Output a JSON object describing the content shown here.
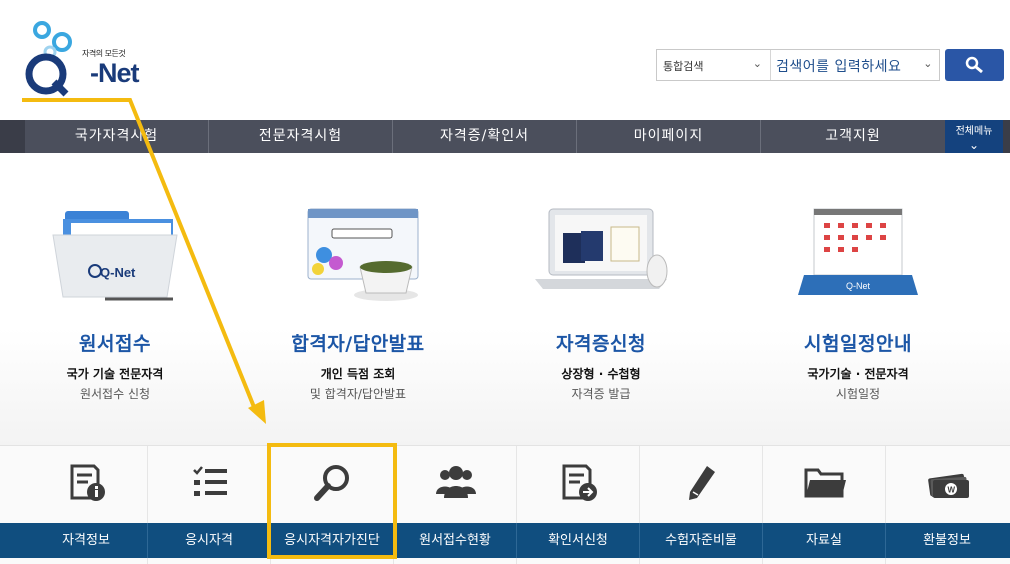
{
  "header": {
    "logo_slogan": "자격의 모든것",
    "logo_brand": "-Net",
    "search": {
      "category": "통합검색",
      "placeholder": "검색어를 입력하세요"
    }
  },
  "gnb": {
    "items": [
      "국가자격시험",
      "전문자격시험",
      "자격증/확인서",
      "마이페이지",
      "고객지원"
    ],
    "all_menu": "전체메뉴"
  },
  "features": [
    {
      "title": "원서접수",
      "line1": "국가 기술 전문자격",
      "line2": "원서접수 신청"
    },
    {
      "title": "합격자/답안발표",
      "line1": "개인 득점 조회",
      "line2": "및 합격자/답안발표"
    },
    {
      "title": "자격증신청",
      "line1": "상장형 · 수첩형",
      "line2": "자격증 발급"
    },
    {
      "title": "시험일정안내",
      "line1": "국가기술 · 전문자격",
      "line2": "시험일정"
    }
  ],
  "quick_menu": [
    {
      "label": "자격정보",
      "icon": "document-info-icon"
    },
    {
      "label": "응시자격",
      "icon": "checklist-icon"
    },
    {
      "label": "응시자격자가진단",
      "icon": "magnifier-icon"
    },
    {
      "label": "원서접수현황",
      "icon": "people-group-icon"
    },
    {
      "label": "확인서신청",
      "icon": "document-arrow-icon"
    },
    {
      "label": "수험자준비물",
      "icon": "pencil-icon"
    },
    {
      "label": "자료실",
      "icon": "folder-icon"
    },
    {
      "label": "환불정보",
      "icon": "money-icon"
    }
  ],
  "colors": {
    "brand_blue": "#1c56a6",
    "gnb_bg": "#4b4f5c",
    "quick_label_bg": "#104e7f",
    "highlight": "#f4bb10"
  }
}
